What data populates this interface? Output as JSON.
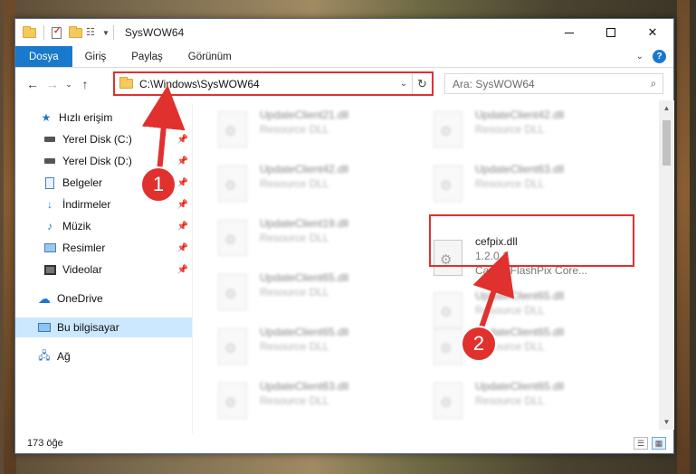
{
  "window": {
    "title": "SysWOW64"
  },
  "ribbon": {
    "tabs": [
      {
        "label": "Dosya",
        "active": true
      },
      {
        "label": "Giriş"
      },
      {
        "label": "Paylaş"
      },
      {
        "label": "Görünüm"
      }
    ],
    "help": "?"
  },
  "nav": {
    "address": "C:\\Windows\\SysWOW64",
    "search_placeholder": "Ara: SysWOW64"
  },
  "sidebar": {
    "items": [
      {
        "label": "Hızlı erişim",
        "icon": "star-icon",
        "pinned": false
      },
      {
        "label": "Yerel Disk (C:)",
        "icon": "drive-icon",
        "pinned": true
      },
      {
        "label": "Yerel Disk (D:)",
        "icon": "drive-icon",
        "pinned": true
      },
      {
        "label": "Belgeler",
        "icon": "documents-icon",
        "pinned": true
      },
      {
        "label": "İndirmeler",
        "icon": "download-icon",
        "pinned": true
      },
      {
        "label": "Müzik",
        "icon": "music-icon",
        "pinned": true
      },
      {
        "label": "Resimler",
        "icon": "pictures-icon",
        "pinned": true
      },
      {
        "label": "Videolar",
        "icon": "videos-icon",
        "pinned": true
      },
      {
        "label": "OneDrive",
        "icon": "cloud-icon",
        "pinned": false
      },
      {
        "label": "Bu bilgisayar",
        "icon": "computer-icon",
        "pinned": false,
        "selected": true
      },
      {
        "label": "Ağ",
        "icon": "network-icon",
        "pinned": false
      }
    ]
  },
  "files": {
    "left": [
      {
        "name": "UpdateClient21.dll",
        "desc": "Resource DLL"
      },
      {
        "name": "UpdateClient42.dll",
        "desc": "Resource DLL"
      },
      {
        "name": "UpdateClient19.dll",
        "desc": "Resource DLL"
      },
      {
        "name": "UpdateClient65.dll",
        "desc": "Resource DLL"
      },
      {
        "name": "UpdateClient65.dll",
        "desc": "Resource DLL"
      },
      {
        "name": "UpdateClient63.dll",
        "desc": "Resource DLL"
      }
    ],
    "right": [
      {
        "name": "UpdateClient42.dll",
        "desc": "Resource DLL"
      },
      {
        "name": "UpdateClient63.dll",
        "desc": "Resource DLL"
      },
      {
        "name": "UpdateClient65.dll",
        "desc": "Resource DLL"
      },
      {
        "name": "UpdateClient65.dll",
        "desc": "Resource DLL"
      },
      {
        "name": "UpdateClient65.dll",
        "desc": "Resource DLL"
      }
    ],
    "target": {
      "name": "cefpix.dll",
      "version": "1.2.0.1",
      "desc": "Canon FlashPix Core..."
    }
  },
  "status": {
    "count": "173 öğe"
  },
  "annotations": {
    "step1": "1",
    "step2": "2",
    "accent": "#e0312f"
  }
}
